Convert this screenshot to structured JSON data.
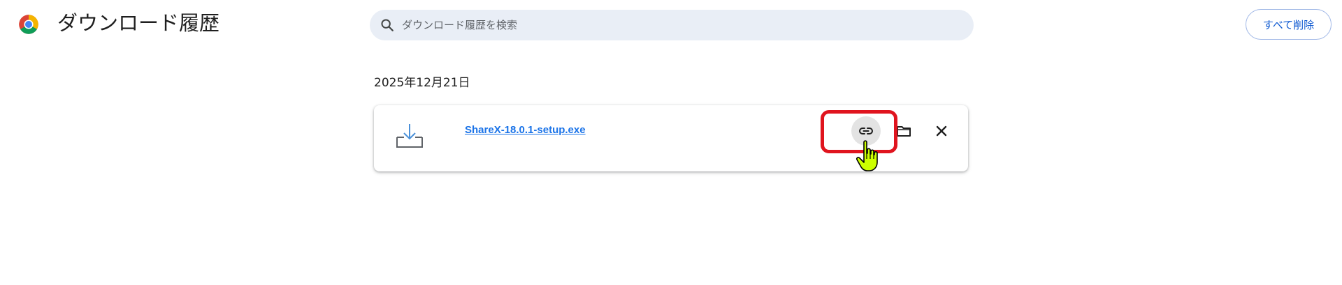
{
  "app": {
    "title": "ダウンロード履歴",
    "logo_icon": "chrome-logo-icon"
  },
  "search": {
    "icon": "search-icon",
    "placeholder": "ダウンロード履歴を検索",
    "value": ""
  },
  "toolbar": {
    "clear_all_label": "すべて削除"
  },
  "downloads": {
    "groups": [
      {
        "date": "2025年12月21日",
        "items": [
          {
            "icon": "download-file-icon",
            "filename": "ShareX-18.0.1-setup.exe",
            "actions": [
              {
                "name": "copy-link",
                "icon": "link-icon"
              },
              {
                "name": "show-in-folder",
                "icon": "folder-icon"
              },
              {
                "name": "remove",
                "icon": "close-icon"
              }
            ]
          }
        ]
      }
    ]
  },
  "overlay": {
    "highlight_color": "#e0141e",
    "cursor_icon": "hand-pointer-icon",
    "cursor_color": "#ccff00"
  },
  "colors": {
    "accent": "#0b57d0",
    "link": "#1a73e8",
    "search_bg": "#e9eef6"
  }
}
